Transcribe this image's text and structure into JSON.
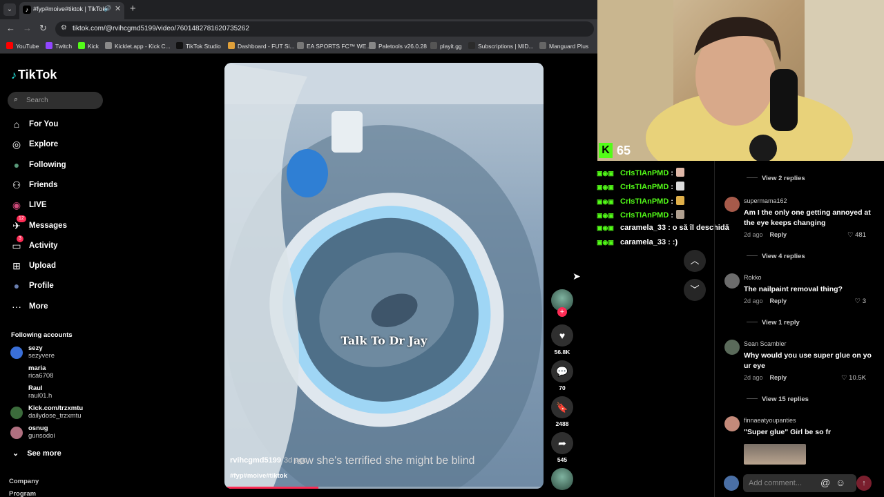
{
  "browser": {
    "tab_title": "#fyp#moive#tiktok | TikTok",
    "url": "tiktok.com/@rvihcgmd5199/video/7601482781620735262",
    "bookmarks": [
      {
        "label": "YouTube",
        "color": "#ff0000"
      },
      {
        "label": "Twitch",
        "color": "#9146ff"
      },
      {
        "label": "Kick",
        "color": "#53fc18"
      },
      {
        "label": "Kicklet.app - Kick C...",
        "color": "#8a8a8a"
      },
      {
        "label": "TikTok Studio",
        "color": "#111111"
      },
      {
        "label": "Dashboard - FUT Si...",
        "color": "#e0a03a"
      },
      {
        "label": "EA SPORTS FC™ WE...",
        "color": "#777777"
      },
      {
        "label": "Paletools v26.0.28",
        "color": "#888888"
      },
      {
        "label": "playit.gg",
        "color": "#555555"
      },
      {
        "label": "Subscriptions | MID...",
        "color": "#2b2b2b"
      },
      {
        "label": "Manguard Plus",
        "color": "#666666"
      }
    ]
  },
  "tiktok": {
    "logo": "TikTok",
    "search_placeholder": "Search",
    "nav": [
      {
        "label": "For You",
        "icon": "home-icon"
      },
      {
        "label": "Explore",
        "icon": "compass-icon"
      },
      {
        "label": "Following",
        "icon": "following-avatar-icon"
      },
      {
        "label": "Friends",
        "icon": "friends-icon"
      },
      {
        "label": "LIVE",
        "icon": "live-icon"
      },
      {
        "label": "Messages",
        "icon": "messages-icon",
        "badge": "12"
      },
      {
        "label": "Activity",
        "icon": "activity-icon",
        "badge": "3"
      },
      {
        "label": "Upload",
        "icon": "upload-icon"
      },
      {
        "label": "Profile",
        "icon": "profile-avatar-icon"
      },
      {
        "label": "More",
        "icon": "more-icon"
      }
    ],
    "following_title": "Following accounts",
    "accounts": [
      {
        "name": "sezy",
        "handle": "sezyvere",
        "color": "#3a6fd8"
      },
      {
        "name": "maria",
        "handle": "rica6708",
        "color": "#000000"
      },
      {
        "name": "Raul",
        "handle": "raul01.h",
        "color": "#000000"
      },
      {
        "name": "Kick.com/trzxmtu",
        "handle": "dailydose_trzxmtu",
        "color": "#3b6b3b"
      },
      {
        "name": "osnug",
        "handle": "gunsodoi",
        "color": "#b07080"
      }
    ],
    "see_more": "See more",
    "footer": [
      "Company",
      "Program"
    ]
  },
  "video": {
    "caption": "Talk To Dr Jay",
    "subtitle": "now she's terrified she might be blind",
    "username": "rvihcgmd5199",
    "time_ago": "3d ago",
    "tags": "#fyp#moive#tiktok",
    "progress_percent": 29
  },
  "actions": {
    "likes": "56.8K",
    "comments": "70",
    "saves": "2488",
    "shares": "545"
  },
  "webcam": {
    "kick_count": "65",
    "kick_color": "#53fc18"
  },
  "chat": [
    {
      "user": "CrIsTIAnPMD",
      "msg": ":",
      "emote": "nail-emote"
    },
    {
      "user": "CrIsTIAnPMD",
      "msg": ":",
      "emote": "bottle-emote"
    },
    {
      "user": "CrIsTIAnPMD",
      "msg": ":",
      "emote": "figure-emote"
    },
    {
      "user": "CrIsTIAnPMD",
      "msg": ":",
      "emote": "face-emote"
    },
    {
      "user": "caramela_33",
      "msg": ": o să îl deschidă",
      "emote": ""
    },
    {
      "user": "caramela_33",
      "msg": ": :)",
      "emote": ""
    }
  ],
  "comments": {
    "top_replies": "View 2 replies",
    "items": [
      {
        "user": "supermama162",
        "text": "Am I the only one getting annoyed at the eye keeps changing",
        "time": "2d ago",
        "reply": "Reply",
        "likes": "481",
        "replies": "View 4 replies",
        "color": "#a65a4a"
      },
      {
        "user": "Rokko",
        "text": "The nailpaint removal thing?",
        "time": "2d ago",
        "reply": "Reply",
        "likes": "3",
        "replies": "View 1 reply",
        "color": "#6c6c6c"
      },
      {
        "user": "Sean Scambler",
        "text": "Why would you use super glue on yo ur eye",
        "time": "2d ago",
        "reply": "Reply",
        "likes": "10.5K",
        "replies": "View 15 replies",
        "color": "#5a6a5a"
      },
      {
        "user": "finnaeatyoupanties",
        "text": "\"Super glue\" Girl be so fr",
        "time": "",
        "reply": "",
        "likes": "",
        "replies": "",
        "color": "#c48a7a"
      }
    ],
    "input_placeholder": "Add comment..."
  }
}
